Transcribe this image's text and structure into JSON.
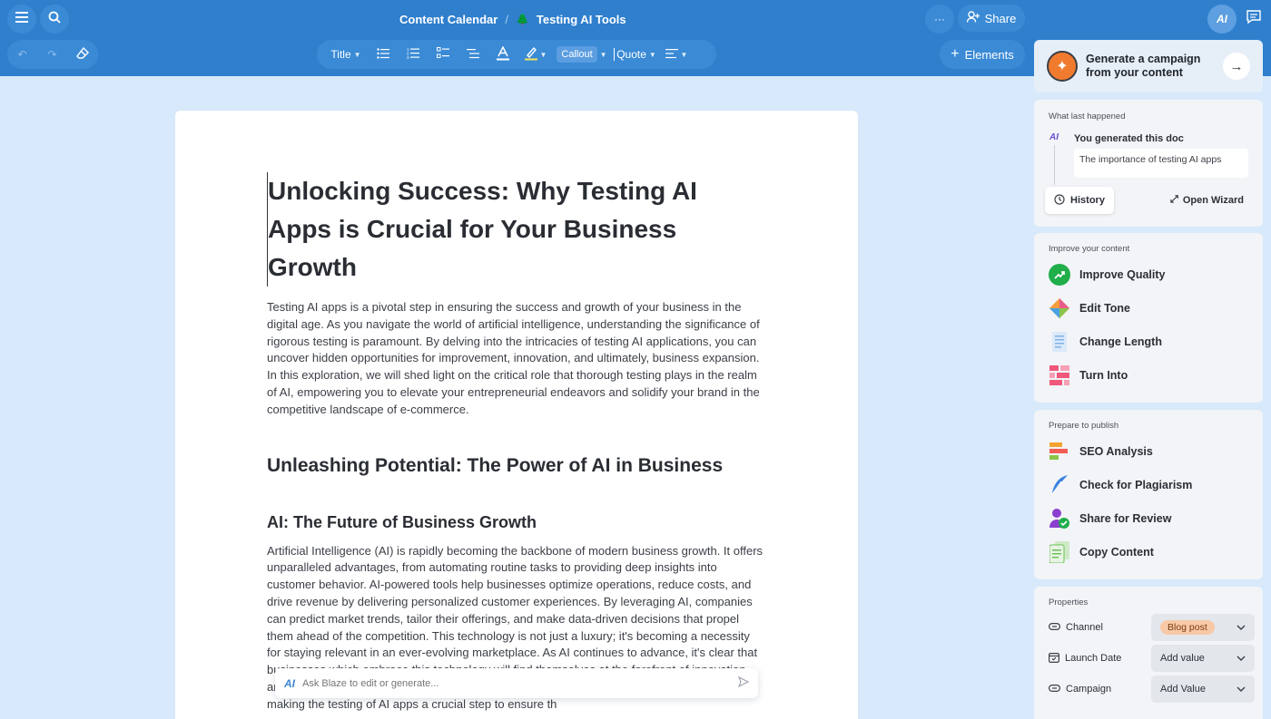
{
  "breadcrumb": {
    "parent": "Content Calendar",
    "separator": "/",
    "current": "Testing AI Tools"
  },
  "header": {
    "share_label": "Share",
    "more_label": "···",
    "ai_label": "AI"
  },
  "toolbar": {
    "title_label": "Title",
    "callout_label": "Callout",
    "quote_label": "Quote",
    "elements_label": "Elements"
  },
  "document": {
    "title": "Unlocking Success: Why Testing AI Apps is Crucial for Your Business Growth",
    "intro": "Testing AI apps is a pivotal step in ensuring the success and growth of your business in the digital age. As you navigate the world of artificial intelligence, understanding the significance of rigorous testing is paramount. By delving into the intricacies of testing AI applications, you can uncover hidden opportunities for improvement, innovation, and ultimately, business expansion. In this exploration, we will shed light on the critical role that thorough testing plays in the realm of AI, empowering you to elevate your entrepreneurial endeavors and solidify your brand in the competitive landscape of e-commerce.",
    "h2": "Unleashing Potential: The Power of AI in Business",
    "h3": "AI: The Future of Business Growth",
    "body": "Artificial Intelligence (AI) is rapidly becoming the backbone of modern business growth. It offers unparalleled advantages, from automating routine tasks to providing deep insights into customer behavior. AI-powered tools help businesses optimize operations, reduce costs, and drive revenue by delivering personalized customer experiences. By leveraging AI, companies can predict market trends, tailor their offerings, and make data-driven decisions that propel them ahead of the competition. This technology is not just a luxury; it's becoming a necessity for staying relevant in an ever-evolving marketplace. As AI continues to advance, it's clear that businesses which embrace this technology will find themselves at the forefront of innovation and success. However, the integration of AI into business processes is not without challenges, making the testing of AI apps a crucial step to ensure th"
  },
  "ask": {
    "placeholder": "Ask Blaze to edit or generate..."
  },
  "sidebar": {
    "campaign": {
      "text": "Generate a campaign from your content"
    },
    "last": {
      "title": "What last happened",
      "event": "You generated this doc",
      "snippet": "The importance of testing AI apps",
      "history_label": "History",
      "wizard_label": "Open Wizard"
    },
    "improve": {
      "title": "Improve your content",
      "items": [
        {
          "label": "Improve Quality",
          "icon": "trend-up-icon",
          "color": "#1fae4a"
        },
        {
          "label": "Edit Tone",
          "icon": "diamond-icon",
          "color": "#e85c8a"
        },
        {
          "label": "Change Length",
          "icon": "document-length-icon",
          "color": "#7fb3e8"
        },
        {
          "label": "Turn Into",
          "icon": "grid-icon",
          "color": "#f0577a"
        }
      ]
    },
    "publish": {
      "title": "Prepare to publish",
      "items": [
        {
          "label": "SEO Analysis",
          "icon": "bars-icon",
          "color": "#f4a331"
        },
        {
          "label": "Check for Plagiarism",
          "icon": "feather-icon",
          "color": "#3b82e0"
        },
        {
          "label": "Share for Review",
          "icon": "user-check-icon",
          "color": "#8b3fd0"
        },
        {
          "label": "Copy Content",
          "icon": "copy-icon",
          "color": "#6bbf59"
        }
      ]
    },
    "properties": {
      "title": "Properties",
      "rows": [
        {
          "label": "Channel",
          "value": "Blog post"
        },
        {
          "label": "Launch Date",
          "value": "Add value"
        },
        {
          "label": "Campaign",
          "value": "Add Value"
        }
      ]
    }
  },
  "colors": {
    "topbar": "#2f7fcd",
    "background": "#d7e9fb",
    "accent": "#3c87d4"
  }
}
